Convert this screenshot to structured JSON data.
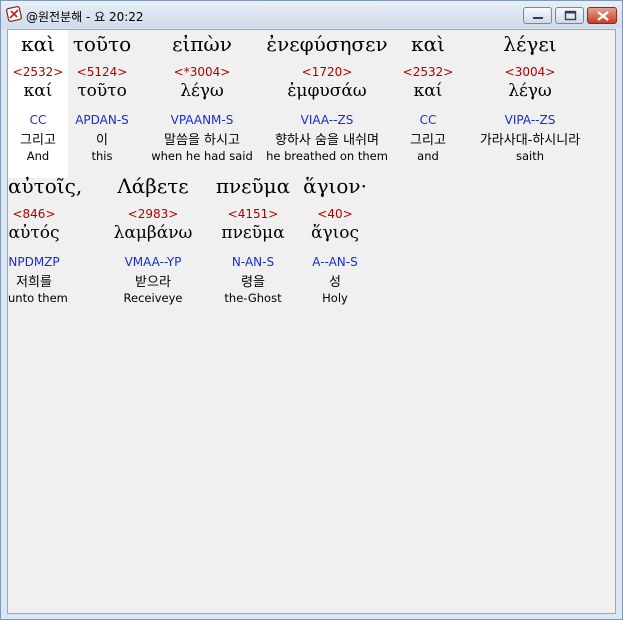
{
  "window": {
    "title": "@원전분해 - 요 20:22"
  },
  "colors": {
    "strong": "#b00000",
    "morph": "#1a2ccc",
    "client_bg": "#f0f0f0",
    "highlight": "#ffffff"
  },
  "icons": {
    "app": "book-cross-icon",
    "minimize": "minimize-icon",
    "maximize": "maximize-icon",
    "close": "close-icon"
  },
  "lines": [
    [
      {
        "greek": "καὶ",
        "strong": "<2532>",
        "lemma": "καί",
        "morph": "CC",
        "korean": "그리고",
        "english": "And"
      },
      {
        "greek": "τοῦτο",
        "strong": "<5124>",
        "lemma": "τοῦτο",
        "morph": "APDAN-S",
        "korean": "이",
        "english": "this"
      },
      {
        "greek": "εἰπὼν",
        "strong": "<*3004>",
        "lemma": "λέγω",
        "morph": "VPAANM-S",
        "korean": "말씀을 하시고",
        "english": "when he had said"
      },
      {
        "greek": "ἐνεφύσησεν",
        "strong": "<1720>",
        "lemma": "ἐμφυσάω",
        "morph": "VIAA--ZS",
        "korean": "향하사 숨을 내쉬며",
        "english": "he breathed on them"
      },
      {
        "greek": "καὶ",
        "strong": "<2532>",
        "lemma": "καί",
        "morph": "CC",
        "korean": "그리고",
        "english": "and"
      },
      {
        "greek": "λέγει",
        "strong": "<3004>",
        "lemma": "λέγω",
        "morph": "VIPA--ZS",
        "korean": "가라사대-하시니라",
        "english": "saith"
      }
    ],
    [
      {
        "greek": "αὐτοῖς,",
        "strong": "<846>",
        "lemma": "αὐτός",
        "morph": "NPDMZP",
        "korean": "저희를",
        "english": "unto them"
      },
      {
        "greek": "Λάβετε",
        "strong": "<2983>",
        "lemma": "λαμβάνω",
        "morph": "VMAA--YP",
        "korean": "받으라",
        "english": "Receiveye"
      },
      {
        "greek": "πνεῦμα",
        "strong": "<4151>",
        "lemma": "πνεῦμα",
        "morph": "N-AN-S",
        "korean": "령을",
        "english": "the-Ghost"
      },
      {
        "greek": "ἅγιον·",
        "strong": "<40>",
        "lemma": "ἅγιος",
        "morph": "A--AN-S",
        "korean": "성",
        "english": "Holy"
      }
    ]
  ]
}
